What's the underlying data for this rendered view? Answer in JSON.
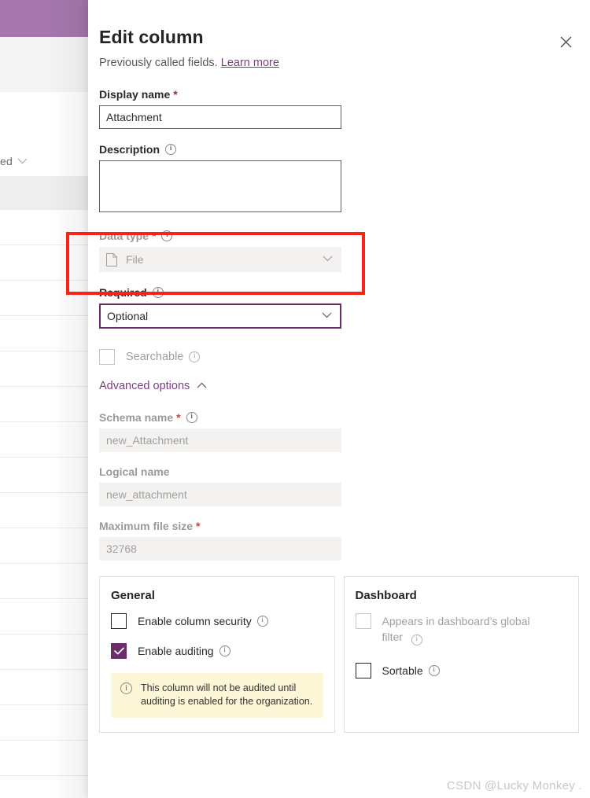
{
  "background": {
    "filter_text": "ed",
    "filter_chevron": "chevron-down-icon"
  },
  "panel": {
    "title": "Edit column",
    "subtitle_prefix": "Previously called fields.",
    "learn_more": "Learn more",
    "close_icon": "close-icon"
  },
  "form": {
    "display_name": {
      "label": "Display name",
      "required_mark": "*",
      "value": "Attachment"
    },
    "description": {
      "label": "Description",
      "info_icon": "info-icon",
      "value": ""
    },
    "data_type": {
      "label": "Data type",
      "required_mark": "*",
      "info_icon": "info-icon",
      "value": "File",
      "value_icon": "file-icon",
      "chevron": "chevron-down-icon",
      "disabled": "true"
    },
    "required": {
      "label": "Required",
      "info_icon": "info-icon",
      "value": "Optional",
      "chevron": "chevron-down-icon",
      "focused": "true"
    },
    "searchable": {
      "label": "Searchable",
      "info_icon": "info-icon",
      "checked": "false",
      "disabled": "true"
    },
    "advanced_options": {
      "label": "Advanced options",
      "chevron": "chevron-up-icon"
    },
    "schema_name": {
      "label": "Schema name",
      "required_mark": "*",
      "info_icon": "info-icon",
      "value": "new_Attachment"
    },
    "logical_name": {
      "label": "Logical name",
      "value": "new_attachment"
    },
    "maximum_file_size": {
      "label": "Maximum file size",
      "required_mark": "*",
      "value": "32768"
    }
  },
  "cards": {
    "general": {
      "title": "General",
      "enable_column_security": {
        "label": "Enable column security",
        "info_icon": "info-icon",
        "checked": "false"
      },
      "enable_auditing": {
        "label": "Enable auditing",
        "info_icon": "info-icon",
        "checked": "true",
        "check_glyph": "✓"
      },
      "audit_banner": {
        "icon": "info-icon",
        "text": "This column will not be audited until auditing is enabled for the organization."
      }
    },
    "dashboard": {
      "title": "Dashboard",
      "appears_in_global_filter": {
        "label": "Appears in dashboard’s global filter",
        "info_icon": "info-icon",
        "checked": "false",
        "disabled": "true"
      },
      "sortable": {
        "label": "Sortable",
        "info_icon": "info-icon",
        "checked": "false"
      }
    }
  },
  "annotation": {
    "color": "#fb2318",
    "target": "data-type-field"
  },
  "watermark": {
    "text": "CSDN @Lucky Monkey ."
  },
  "colors": {
    "accent_purple": "#6b2e6b",
    "link_purple": "#7b3f7e",
    "header_purple": "#a577ad",
    "required_red": "#a4262c",
    "banner_yellow": "#fdf6d7"
  }
}
